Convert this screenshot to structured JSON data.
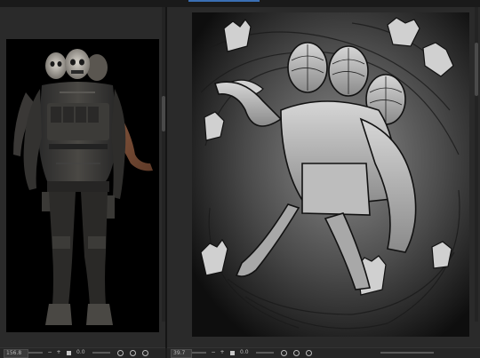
{
  "window": {
    "accent_color": "#3a6fb4"
  },
  "left_view": {
    "zoom": "156.8",
    "angle": "0.0",
    "canvas_content": "soldier-figure-reference"
  },
  "right_view": {
    "zoom": "39.7",
    "angle": "0.0",
    "canvas_content": "monochrome-sketch-figures"
  },
  "statusbar": {
    "zoom_out_icon": "minus-icon",
    "zoom_in_icon": "plus-icon",
    "reset_icon": "square-icon",
    "rotate_left_icon": "rotate-left-icon",
    "rotate_right_icon": "rotate-right-icon",
    "zoom_out": "−",
    "zoom_in": "+"
  }
}
